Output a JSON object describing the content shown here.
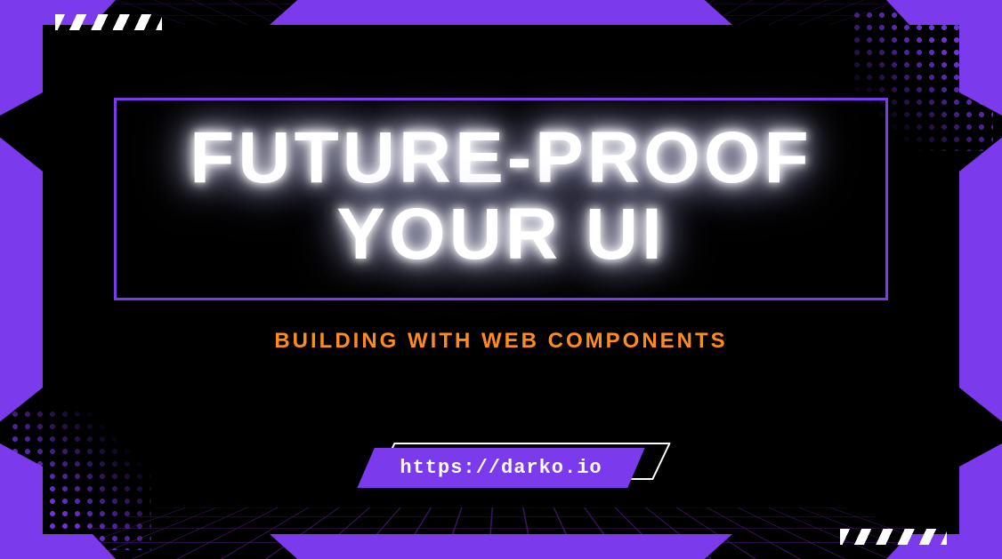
{
  "title": "FUTURE-PROOF YOUR UI",
  "subtitle": "BUILDING WITH WEB COMPONENTS",
  "url": "https://darko.io",
  "colors": {
    "accent": "#7c3aed",
    "subtitle": "#ff8c1a",
    "background": "#000000",
    "glow": "#ffffff"
  }
}
